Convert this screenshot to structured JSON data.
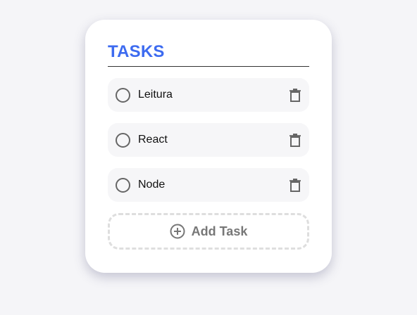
{
  "card": {
    "title": "TASKS"
  },
  "tasks": [
    {
      "label": "Leitura",
      "done": false
    },
    {
      "label": "React",
      "done": false
    },
    {
      "label": "Node",
      "done": false
    }
  ],
  "add_button": {
    "label": "Add Task",
    "icon": "plus-circle-icon"
  },
  "colors": {
    "accent": "#3d6bf0",
    "background": "#f5f5f8",
    "card": "#ffffff",
    "task_bg": "#f6f6f8"
  },
  "icons": {
    "checkbox": "circle-outline",
    "delete": "trash-icon"
  }
}
